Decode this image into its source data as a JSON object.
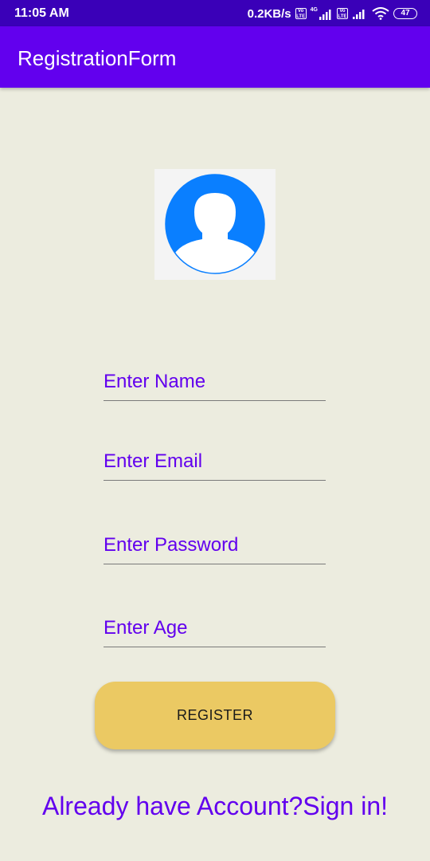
{
  "status_bar": {
    "time": "11:05 AM",
    "network_speed": "0.2KB/s",
    "sim1_tag": "Vo LTE",
    "network_type": "4G",
    "sim2_tag": "Vo LTE",
    "battery": "47",
    "icons": [
      "volte-icon",
      "signal-icon",
      "volte-icon",
      "signal-icon",
      "wifi-icon",
      "battery-icon"
    ]
  },
  "app_bar": {
    "title": "RegistrationForm"
  },
  "form": {
    "avatar_icon": "user-avatar-icon",
    "name_placeholder": "Enter Name",
    "email_placeholder": "Enter Email",
    "password_placeholder": "Enter Password",
    "age_placeholder": "Enter Age",
    "register_label": "REGISTER",
    "signin_link": "Already have Account?Sign in!"
  },
  "colors": {
    "status_bar": "#3A00B8",
    "primary": "#6200EE",
    "background": "#ECECDF",
    "button": "#EBC963",
    "avatar": "#0A7FFF"
  }
}
